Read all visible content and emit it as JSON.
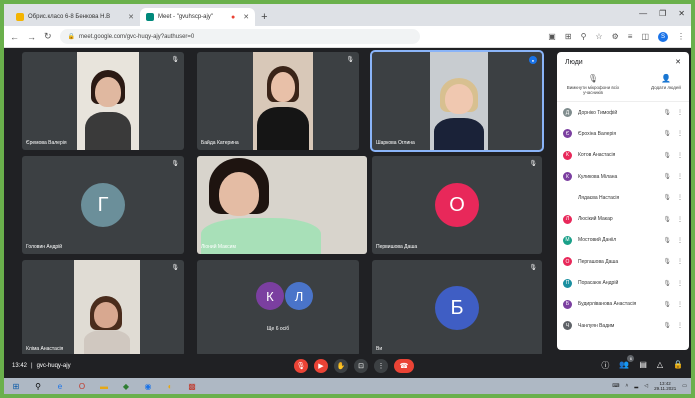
{
  "browser": {
    "tabs": [
      {
        "title": "Обрис.класо 6-8 Бенкова Н.В",
        "active": false
      },
      {
        "title": "Meet - \"gvuhscp-ajy\"",
        "active": true
      }
    ],
    "url": "meet.google.com/gvc-huqy-ajy?authuser=0"
  },
  "tiles": [
    {
      "name": "Єремова Валерія",
      "kind": "video"
    },
    {
      "name": "Байда Катерина",
      "kind": "video"
    },
    {
      "name": "Шаркова Оглина",
      "kind": "video"
    },
    {
      "name": "Головин Андрій",
      "kind": "avatar",
      "initial": "Г",
      "color": "#6b8f9a"
    },
    {
      "name": "Ліоний Максим",
      "kind": "video"
    },
    {
      "name": "Первишова Даша",
      "kind": "avatar",
      "initial": "О",
      "color": "#e8285a"
    },
    {
      "name": "Кліма Анастасія",
      "kind": "video"
    },
    {
      "name": "Ще 6 осіб",
      "kind": "group",
      "initials": [
        "К",
        "Л"
      ],
      "colors": [
        "#7b3fa0",
        "#4a74c9"
      ]
    },
    {
      "name": "Ви",
      "kind": "avatar",
      "initial": "Б",
      "color": "#3f5ec4"
    }
  ],
  "people_panel": {
    "title": "Люди",
    "mute_all": "Вимкнути мікрофони всіх учасників",
    "add_people": "Додати людей",
    "participants": [
      {
        "name": "Дорніко Тимофій",
        "initial": "Д",
        "color": "#7f8c8d"
      },
      {
        "name": "Єрохіна Валерія",
        "initial": "Є",
        "color": "#7b3fa0"
      },
      {
        "name": "Котов Анастасія",
        "initial": "К",
        "color": "#e8285a"
      },
      {
        "name": "Куликова Мілана",
        "initial": "К",
        "color": "#7b3fa0"
      },
      {
        "name": "Лядаєва Настасія",
        "initial": "",
        "color": "#ffffff"
      },
      {
        "name": "Люсікий Макар",
        "initial": "Л",
        "color": "#e8285a"
      },
      {
        "name": "Мостовий Данііл",
        "initial": "М",
        "color": "#1aa089"
      },
      {
        "name": "Пергашова Даша",
        "initial": "О",
        "color": "#e8285a"
      },
      {
        "name": "Порасаюк Андрій",
        "initial": "П",
        "color": "#1a8fa0"
      },
      {
        "name": "Будирліванова Анастасія",
        "initial": "Б",
        "color": "#7b3fa0"
      },
      {
        "name": "Чанлуян Вадим",
        "initial": "Ч",
        "color": "#5f6368"
      }
    ]
  },
  "bottom": {
    "time": "13:42",
    "code": "gvc-huqy-ajy",
    "people_count": "6"
  },
  "taskbar": {
    "clock_time": "13:42",
    "clock_date": "29.11.2021"
  }
}
